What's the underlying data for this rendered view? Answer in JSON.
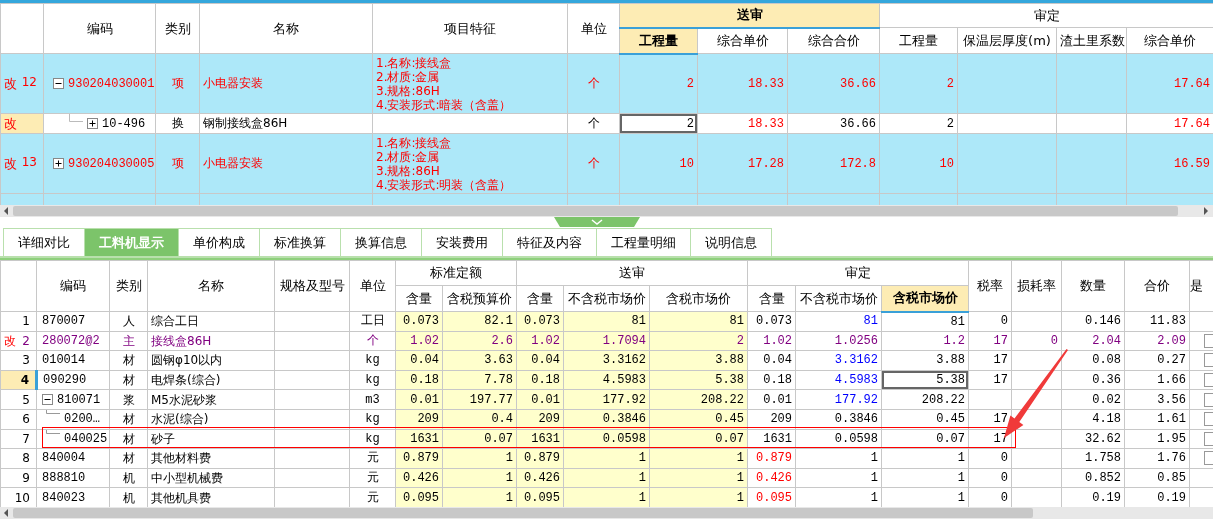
{
  "top_table": {
    "header": [
      {
        "kind": "single",
        "label": "编码"
      },
      {
        "kind": "single",
        "label": "类别"
      },
      {
        "kind": "single",
        "label": "名称"
      },
      {
        "kind": "single",
        "label": "项目特征"
      },
      {
        "kind": "single",
        "label": "单位"
      },
      {
        "kind": "group",
        "label": "送审",
        "selected": true,
        "shaded": false,
        "columns": [
          {
            "label": "工程量",
            "selected": true
          },
          {
            "label": "综合单价",
            "selected": false
          },
          {
            "label": "综合合价",
            "selected": false
          }
        ]
      },
      {
        "kind": "group",
        "label": "审定",
        "selected": false,
        "shaded": false,
        "columns": [
          {
            "label": "工程量",
            "selected": false
          },
          {
            "label": "保温层厚度(m)",
            "selected": false
          },
          {
            "label": "渣土里系数",
            "selected": false
          },
          {
            "label": "综合单价",
            "selected": false
          }
        ]
      }
    ],
    "rows": [
      {
        "kind": "item",
        "flag": "改",
        "number": "12",
        "selected": false,
        "expanded": true,
        "code": "930204030001",
        "type": "项",
        "name": "小电器安装",
        "features": [
          "1.名称:接线盒",
          "2.材质:金属",
          "3.规格:86H",
          "4.安装形式:暗装（含盖）"
        ],
        "unit": "个",
        "values": [
          {
            "text": "2",
            "kind": "changed"
          },
          {
            "text": "18.33",
            "kind": "changed"
          },
          {
            "text": "36.66",
            "kind": "changed"
          },
          {
            "text": "2",
            "kind": "changed"
          },
          {
            "kind": "plain"
          },
          {
            "kind": "plain"
          },
          {
            "text": "17.64",
            "kind": "changed"
          }
        ],
        "children": [
          {
            "kind": "sub",
            "flag": "改",
            "selected": true,
            "expanded": false,
            "code": "10-496",
            "type": "换",
            "name": "钢制接线盒86H",
            "unit": "个",
            "values": [
              {
                "text": "2",
                "kind": "focused"
              },
              {
                "text": "18.33",
                "kind": "changed"
              },
              {
                "text": "36.66",
                "kind": "plain"
              },
              {
                "text": "2",
                "kind": "plain"
              },
              {
                "kind": "plain"
              },
              {
                "kind": "plain"
              },
              {
                "text": "17.64",
                "kind": "changed"
              }
            ]
          }
        ]
      },
      {
        "kind": "item",
        "flag": "改",
        "number": "13",
        "selected": false,
        "expanded": false,
        "code": "930204030005",
        "type": "项",
        "name": "小电器安装",
        "features": [
          "1.名称:接线盒",
          "2.材质:金属",
          "3.规格:86H",
          "4.安装形式:明装（含盖）"
        ],
        "unit": "个",
        "values": [
          {
            "text": "10",
            "kind": "changed"
          },
          {
            "text": "17.28",
            "kind": "changed"
          },
          {
            "text": "172.8",
            "kind": "changed"
          },
          {
            "text": "10",
            "kind": "changed"
          },
          {
            "kind": "plain"
          },
          {
            "kind": "plain"
          },
          {
            "text": "16.59",
            "kind": "changed"
          }
        ]
      }
    ]
  },
  "tabs": [
    {
      "label": "详细对比",
      "selected": false
    },
    {
      "label": "工料机显示",
      "selected": true
    },
    {
      "label": "单价构成",
      "selected": false
    },
    {
      "label": "标准换算",
      "selected": false
    },
    {
      "label": "换算信息",
      "selected": false
    },
    {
      "label": "安装费用",
      "selected": false
    },
    {
      "label": "特征及内容",
      "selected": false
    },
    {
      "label": "工程量明细",
      "selected": false
    },
    {
      "label": "说明信息",
      "selected": false
    }
  ],
  "bottom_table": {
    "header": [
      {
        "kind": "single",
        "label": "编码"
      },
      {
        "kind": "single",
        "label": "类别"
      },
      {
        "kind": "single",
        "label": "名称"
      },
      {
        "kind": "single",
        "label": "规格及型号"
      },
      {
        "kind": "single",
        "label": "单位"
      },
      {
        "kind": "group",
        "label": "标准定额",
        "selected": false,
        "shaded": true,
        "columns": [
          {
            "label": "含量",
            "selected": false
          },
          {
            "label": "含税预算价",
            "selected": false
          }
        ]
      },
      {
        "kind": "group",
        "label": "送审",
        "selected": false,
        "shaded": true,
        "columns": [
          {
            "label": "含量",
            "selected": false
          },
          {
            "label": "不含税市场价",
            "selected": false
          },
          {
            "label": "含税市场价",
            "selected": false
          }
        ]
      },
      {
        "kind": "group",
        "label": "审定",
        "selected": false,
        "shaded": false,
        "columns": [
          {
            "label": "含量",
            "selected": false
          },
          {
            "label": "不含税市场价",
            "selected": false
          },
          {
            "label": "含税市场价",
            "selected": true
          }
        ]
      },
      {
        "kind": "single",
        "label": "税率"
      },
      {
        "kind": "single",
        "label": "损耗率"
      },
      {
        "kind": "single",
        "label": "数量"
      },
      {
        "kind": "single",
        "label": "合价"
      },
      {
        "kind": "single",
        "label": "是"
      }
    ],
    "rows": [
      {
        "kind": "normal",
        "number": "1",
        "selected": false,
        "code": "870007",
        "type": "人",
        "name": "综合工日",
        "unit": "工日",
        "checkbox": false,
        "values": [
          {
            "text": "0.073",
            "kind": "plain"
          },
          {
            "text": "82.1",
            "kind": "plain"
          },
          {
            "text": "0.073",
            "kind": "plain"
          },
          {
            "text": "81",
            "kind": "plain"
          },
          {
            "text": "81",
            "kind": "plain"
          },
          {
            "text": "0.073",
            "kind": "plain"
          },
          {
            "text": "81",
            "kind": "edited"
          },
          {
            "text": "81",
            "kind": "plain"
          },
          {
            "text": "0",
            "kind": "plain"
          },
          {
            "kind": "plain"
          },
          {
            "text": "0.146",
            "kind": "plain"
          },
          {
            "text": "11.83",
            "kind": "plain"
          }
        ]
      },
      {
        "kind": "main",
        "flag": "改",
        "number": "2",
        "selected": false,
        "code": "280072@2",
        "type": "主",
        "name": "接线盒86H",
        "unit": "个",
        "checkbox": true,
        "values": [
          {
            "text": "1.02",
            "kind": "plain"
          },
          {
            "text": "2.6",
            "kind": "plain"
          },
          {
            "text": "1.02",
            "kind": "plain"
          },
          {
            "text": "1.7094",
            "kind": "plain"
          },
          {
            "text": "2",
            "kind": "plain"
          },
          {
            "text": "1.02",
            "kind": "plain"
          },
          {
            "text": "1.0256",
            "kind": "plain"
          },
          {
            "text": "1.2",
            "kind": "plain"
          },
          {
            "text": "17",
            "kind": "plain"
          },
          {
            "text": "0",
            "kind": "plain"
          },
          {
            "text": "2.04",
            "kind": "plain"
          },
          {
            "text": "2.09",
            "kind": "plain"
          }
        ]
      },
      {
        "kind": "normal",
        "number": "3",
        "selected": false,
        "code": "010014",
        "type": "材",
        "name": "圆钢φ10以内",
        "unit": "kg",
        "checkbox": true,
        "values": [
          {
            "text": "0.04",
            "kind": "plain"
          },
          {
            "text": "3.63",
            "kind": "plain"
          },
          {
            "text": "0.04",
            "kind": "plain"
          },
          {
            "text": "3.3162",
            "kind": "plain"
          },
          {
            "text": "3.88",
            "kind": "plain"
          },
          {
            "text": "0.04",
            "kind": "plain"
          },
          {
            "text": "3.3162",
            "kind": "edited"
          },
          {
            "text": "3.88",
            "kind": "plain"
          },
          {
            "text": "17",
            "kind": "plain"
          },
          {
            "kind": "plain"
          },
          {
            "text": "0.08",
            "kind": "plain"
          },
          {
            "text": "0.27",
            "kind": "plain"
          }
        ]
      },
      {
        "kind": "normal",
        "number": "4",
        "selected": true,
        "code": "090290",
        "type": "材",
        "name": "电焊条(综合)",
        "unit": "kg",
        "checkbox": true,
        "values": [
          {
            "text": "0.18",
            "kind": "plain"
          },
          {
            "text": "7.78",
            "kind": "plain"
          },
          {
            "text": "0.18",
            "kind": "plain"
          },
          {
            "text": "4.5983",
            "kind": "plain"
          },
          {
            "text": "5.38",
            "kind": "plain"
          },
          {
            "text": "0.18",
            "kind": "plain"
          },
          {
            "text": "4.5983",
            "kind": "edited"
          },
          {
            "text": "5.38",
            "kind": "focused"
          },
          {
            "text": "17",
            "kind": "plain"
          },
          {
            "kind": "plain"
          },
          {
            "text": "0.36",
            "kind": "plain"
          },
          {
            "text": "1.66",
            "kind": "plain"
          }
        ]
      },
      {
        "kind": "normal",
        "number": "5",
        "selected": false,
        "expanded": true,
        "code": "810071",
        "type": "浆",
        "name": "M5水泥砂浆",
        "unit": "m3",
        "checkbox": true,
        "values": [
          {
            "text": "0.01",
            "kind": "plain"
          },
          {
            "text": "197.77",
            "kind": "plain"
          },
          {
            "text": "0.01",
            "kind": "plain"
          },
          {
            "text": "177.92",
            "kind": "plain"
          },
          {
            "text": "208.22",
            "kind": "plain"
          },
          {
            "text": "0.01",
            "kind": "plain"
          },
          {
            "text": "177.92",
            "kind": "edited"
          },
          {
            "text": "208.22",
            "kind": "plain"
          },
          {
            "kind": "plain"
          },
          {
            "kind": "plain"
          },
          {
            "text": "0.02",
            "kind": "plain"
          },
          {
            "text": "3.56",
            "kind": "plain"
          }
        ],
        "children": [
          {
            "kind": "normal",
            "number": "6",
            "selected": false,
            "code": "0200…",
            "type": "材",
            "name": "水泥(综合)",
            "unit": "kg",
            "checkbox": true,
            "values": [
              {
                "text": "209",
                "kind": "plain"
              },
              {
                "text": "0.4",
                "kind": "plain"
              },
              {
                "text": "209",
                "kind": "plain"
              },
              {
                "text": "0.3846",
                "kind": "plain"
              },
              {
                "text": "0.45",
                "kind": "plain"
              },
              {
                "text": "209",
                "kind": "plain"
              },
              {
                "text": "0.3846",
                "kind": "plain"
              },
              {
                "text": "0.45",
                "kind": "plain"
              },
              {
                "text": "17",
                "kind": "plain"
              },
              {
                "kind": "plain"
              },
              {
                "text": "4.18",
                "kind": "plain"
              },
              {
                "text": "1.61",
                "kind": "plain"
              }
            ]
          },
          {
            "kind": "normal",
            "number": "7",
            "selected": false,
            "code": "040025",
            "type": "材",
            "name": "砂子",
            "unit": "kg",
            "checkbox": true,
            "values": [
              {
                "text": "1631",
                "kind": "plain"
              },
              {
                "text": "0.07",
                "kind": "plain"
              },
              {
                "text": "1631",
                "kind": "plain"
              },
              {
                "text": "0.0598",
                "kind": "plain"
              },
              {
                "text": "0.07",
                "kind": "plain"
              },
              {
                "text": "1631",
                "kind": "plain"
              },
              {
                "text": "0.0598",
                "kind": "plain"
              },
              {
                "text": "0.07",
                "kind": "plain"
              },
              {
                "text": "17",
                "kind": "plain"
              },
              {
                "kind": "plain"
              },
              {
                "text": "32.62",
                "kind": "plain"
              },
              {
                "text": "1.95",
                "kind": "plain"
              }
            ]
          }
        ]
      },
      {
        "kind": "normal",
        "number": "8",
        "selected": false,
        "code": "840004",
        "type": "材",
        "name": "其他材料费",
        "unit": "元",
        "checkbox": true,
        "values": [
          {
            "text": "0.879",
            "kind": "plain"
          },
          {
            "text": "1",
            "kind": "plain"
          },
          {
            "text": "0.879",
            "kind": "plain"
          },
          {
            "text": "1",
            "kind": "plain"
          },
          {
            "text": "1",
            "kind": "plain"
          },
          {
            "text": "0.879",
            "kind": "alert"
          },
          {
            "text": "1",
            "kind": "plain"
          },
          {
            "text": "1",
            "kind": "plain"
          },
          {
            "text": "0",
            "kind": "plain"
          },
          {
            "kind": "plain"
          },
          {
            "text": "1.758",
            "kind": "plain"
          },
          {
            "text": "1.76",
            "kind": "plain"
          }
        ]
      },
      {
        "kind": "normal",
        "number": "9",
        "selected": false,
        "code": "888810",
        "type": "机",
        "name": "中小型机械费",
        "unit": "元",
        "checkbox": false,
        "values": [
          {
            "text": "0.426",
            "kind": "plain"
          },
          {
            "text": "1",
            "kind": "plain"
          },
          {
            "text": "0.426",
            "kind": "plain"
          },
          {
            "text": "1",
            "kind": "plain"
          },
          {
            "text": "1",
            "kind": "plain"
          },
          {
            "text": "0.426",
            "kind": "alert"
          },
          {
            "text": "1",
            "kind": "plain"
          },
          {
            "text": "1",
            "kind": "plain"
          },
          {
            "text": "0",
            "kind": "plain"
          },
          {
            "kind": "plain"
          },
          {
            "text": "0.852",
            "kind": "plain"
          },
          {
            "text": "0.85",
            "kind": "plain"
          }
        ]
      },
      {
        "kind": "normal",
        "number": "10",
        "selected": false,
        "code": "840023",
        "type": "机",
        "name": "其他机具费",
        "unit": "元",
        "checkbox": false,
        "values": [
          {
            "text": "0.095",
            "kind": "plain"
          },
          {
            "text": "1",
            "kind": "plain"
          },
          {
            "text": "0.095",
            "kind": "plain"
          },
          {
            "text": "1",
            "kind": "plain"
          },
          {
            "text": "1",
            "kind": "plain"
          },
          {
            "text": "0.095",
            "kind": "alert"
          },
          {
            "text": "1",
            "kind": "plain"
          },
          {
            "text": "1",
            "kind": "plain"
          },
          {
            "text": "0",
            "kind": "plain"
          },
          {
            "kind": "plain"
          },
          {
            "text": "0.19",
            "kind": "plain"
          },
          {
            "text": "0.19",
            "kind": "plain"
          }
        ]
      }
    ]
  }
}
